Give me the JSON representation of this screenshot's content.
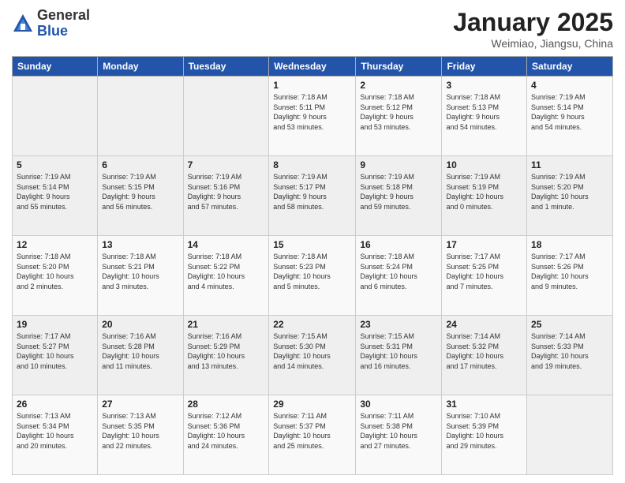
{
  "header": {
    "logo_general": "General",
    "logo_blue": "Blue",
    "month_title": "January 2025",
    "subtitle": "Weimiao, Jiangsu, China"
  },
  "days_of_week": [
    "Sunday",
    "Monday",
    "Tuesday",
    "Wednesday",
    "Thursday",
    "Friday",
    "Saturday"
  ],
  "weeks": [
    [
      {
        "day": "",
        "info": ""
      },
      {
        "day": "",
        "info": ""
      },
      {
        "day": "",
        "info": ""
      },
      {
        "day": "1",
        "info": "Sunrise: 7:18 AM\nSunset: 5:11 PM\nDaylight: 9 hours\nand 53 minutes."
      },
      {
        "day": "2",
        "info": "Sunrise: 7:18 AM\nSunset: 5:12 PM\nDaylight: 9 hours\nand 53 minutes."
      },
      {
        "day": "3",
        "info": "Sunrise: 7:18 AM\nSunset: 5:13 PM\nDaylight: 9 hours\nand 54 minutes."
      },
      {
        "day": "4",
        "info": "Sunrise: 7:19 AM\nSunset: 5:14 PM\nDaylight: 9 hours\nand 54 minutes."
      }
    ],
    [
      {
        "day": "5",
        "info": "Sunrise: 7:19 AM\nSunset: 5:14 PM\nDaylight: 9 hours\nand 55 minutes."
      },
      {
        "day": "6",
        "info": "Sunrise: 7:19 AM\nSunset: 5:15 PM\nDaylight: 9 hours\nand 56 minutes."
      },
      {
        "day": "7",
        "info": "Sunrise: 7:19 AM\nSunset: 5:16 PM\nDaylight: 9 hours\nand 57 minutes."
      },
      {
        "day": "8",
        "info": "Sunrise: 7:19 AM\nSunset: 5:17 PM\nDaylight: 9 hours\nand 58 minutes."
      },
      {
        "day": "9",
        "info": "Sunrise: 7:19 AM\nSunset: 5:18 PM\nDaylight: 9 hours\nand 59 minutes."
      },
      {
        "day": "10",
        "info": "Sunrise: 7:19 AM\nSunset: 5:19 PM\nDaylight: 10 hours\nand 0 minutes."
      },
      {
        "day": "11",
        "info": "Sunrise: 7:19 AM\nSunset: 5:20 PM\nDaylight: 10 hours\nand 1 minute."
      }
    ],
    [
      {
        "day": "12",
        "info": "Sunrise: 7:18 AM\nSunset: 5:20 PM\nDaylight: 10 hours\nand 2 minutes."
      },
      {
        "day": "13",
        "info": "Sunrise: 7:18 AM\nSunset: 5:21 PM\nDaylight: 10 hours\nand 3 minutes."
      },
      {
        "day": "14",
        "info": "Sunrise: 7:18 AM\nSunset: 5:22 PM\nDaylight: 10 hours\nand 4 minutes."
      },
      {
        "day": "15",
        "info": "Sunrise: 7:18 AM\nSunset: 5:23 PM\nDaylight: 10 hours\nand 5 minutes."
      },
      {
        "day": "16",
        "info": "Sunrise: 7:18 AM\nSunset: 5:24 PM\nDaylight: 10 hours\nand 6 minutes."
      },
      {
        "day": "17",
        "info": "Sunrise: 7:17 AM\nSunset: 5:25 PM\nDaylight: 10 hours\nand 7 minutes."
      },
      {
        "day": "18",
        "info": "Sunrise: 7:17 AM\nSunset: 5:26 PM\nDaylight: 10 hours\nand 9 minutes."
      }
    ],
    [
      {
        "day": "19",
        "info": "Sunrise: 7:17 AM\nSunset: 5:27 PM\nDaylight: 10 hours\nand 10 minutes."
      },
      {
        "day": "20",
        "info": "Sunrise: 7:16 AM\nSunset: 5:28 PM\nDaylight: 10 hours\nand 11 minutes."
      },
      {
        "day": "21",
        "info": "Sunrise: 7:16 AM\nSunset: 5:29 PM\nDaylight: 10 hours\nand 13 minutes."
      },
      {
        "day": "22",
        "info": "Sunrise: 7:15 AM\nSunset: 5:30 PM\nDaylight: 10 hours\nand 14 minutes."
      },
      {
        "day": "23",
        "info": "Sunrise: 7:15 AM\nSunset: 5:31 PM\nDaylight: 10 hours\nand 16 minutes."
      },
      {
        "day": "24",
        "info": "Sunrise: 7:14 AM\nSunset: 5:32 PM\nDaylight: 10 hours\nand 17 minutes."
      },
      {
        "day": "25",
        "info": "Sunrise: 7:14 AM\nSunset: 5:33 PM\nDaylight: 10 hours\nand 19 minutes."
      }
    ],
    [
      {
        "day": "26",
        "info": "Sunrise: 7:13 AM\nSunset: 5:34 PM\nDaylight: 10 hours\nand 20 minutes."
      },
      {
        "day": "27",
        "info": "Sunrise: 7:13 AM\nSunset: 5:35 PM\nDaylight: 10 hours\nand 22 minutes."
      },
      {
        "day": "28",
        "info": "Sunrise: 7:12 AM\nSunset: 5:36 PM\nDaylight: 10 hours\nand 24 minutes."
      },
      {
        "day": "29",
        "info": "Sunrise: 7:11 AM\nSunset: 5:37 PM\nDaylight: 10 hours\nand 25 minutes."
      },
      {
        "day": "30",
        "info": "Sunrise: 7:11 AM\nSunset: 5:38 PM\nDaylight: 10 hours\nand 27 minutes."
      },
      {
        "day": "31",
        "info": "Sunrise: 7:10 AM\nSunset: 5:39 PM\nDaylight: 10 hours\nand 29 minutes."
      },
      {
        "day": "",
        "info": ""
      }
    ]
  ]
}
